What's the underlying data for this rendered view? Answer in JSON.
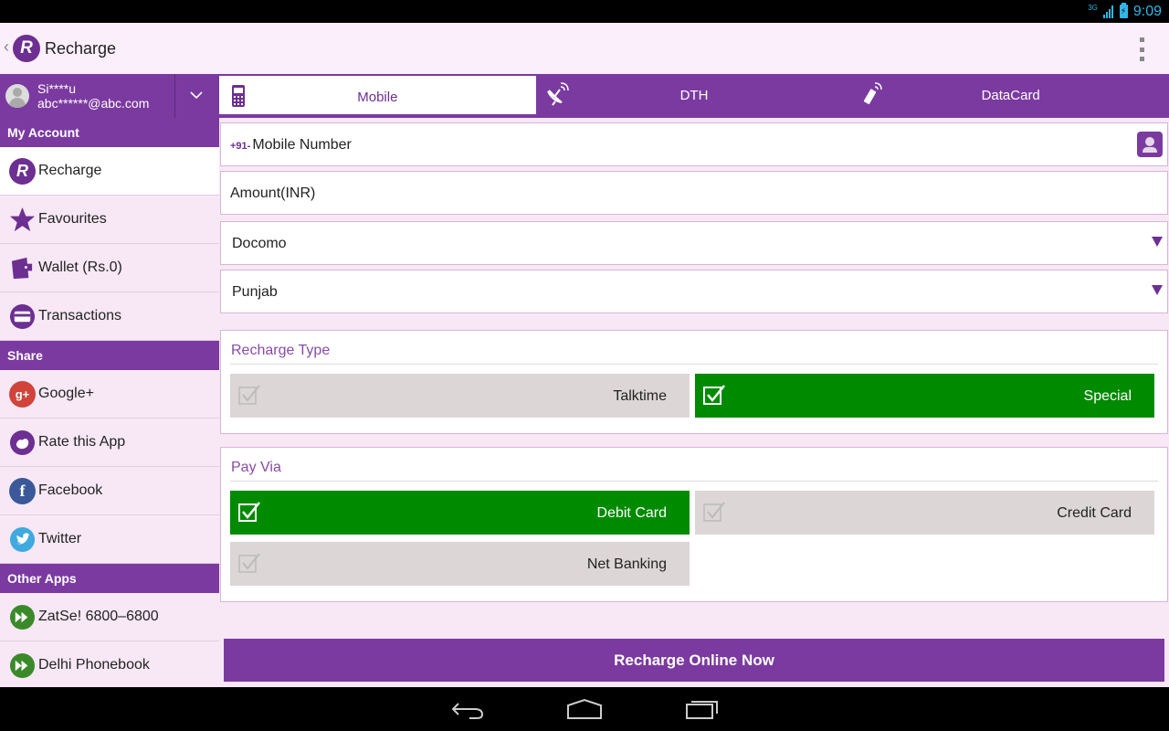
{
  "status_bar": {
    "network": "3G",
    "battery_glyph": "⚡",
    "time": "9:09"
  },
  "action_bar": {
    "logo_letter": "R",
    "title": "Recharge",
    "up_caret": "‹"
  },
  "account": {
    "name": "Si****u",
    "email": "abc******@abc.com"
  },
  "sidebar": {
    "my_account_header": "My Account",
    "my_account_items": [
      {
        "label": "Recharge",
        "icon": "recharge-logo-icon"
      },
      {
        "label": "Favourites",
        "icon": "star-icon"
      },
      {
        "label": "Wallet (Rs.0)",
        "icon": "wallet-icon"
      },
      {
        "label": "Transactions",
        "icon": "card-icon"
      }
    ],
    "share_header": "Share",
    "share_items": [
      {
        "label": "Google+",
        "icon": "google-plus-icon"
      },
      {
        "label": "Rate this App",
        "icon": "rate-icon"
      },
      {
        "label": "Facebook",
        "icon": "facebook-icon"
      },
      {
        "label": "Twitter",
        "icon": "twitter-icon"
      }
    ],
    "other_apps_header": "Other Apps",
    "other_apps_items": [
      {
        "label": "ZatSe! 6800–6800",
        "icon": "app-play-icon"
      },
      {
        "label": "Delhi Phonebook",
        "icon": "app-play-icon"
      }
    ]
  },
  "tabs": [
    {
      "label": "Mobile",
      "selected": true,
      "icon": "mobile-icon"
    },
    {
      "label": "DTH",
      "selected": false,
      "icon": "satellite-dish-icon"
    },
    {
      "label": "DataCard",
      "selected": false,
      "icon": "usb-modem-icon"
    }
  ],
  "form": {
    "mobile_prefix": "+91-",
    "mobile_placeholder": "Mobile Number",
    "amount_placeholder": "Amount(INR)",
    "operator_selected": "Docomo",
    "circle_selected": "Punjab"
  },
  "recharge_type": {
    "title": "Recharge Type",
    "options": [
      {
        "label": "Talktime",
        "checked": false
      },
      {
        "label": "Special",
        "checked": true
      }
    ]
  },
  "pay_via": {
    "title": "Pay Via",
    "options": [
      {
        "label": "Debit Card",
        "checked": true
      },
      {
        "label": "Credit Card",
        "checked": false
      },
      {
        "label": "Net Banking",
        "checked": false
      }
    ]
  },
  "cta_label": "Recharge Online Now",
  "colors": {
    "brand_purple": "#7b3aa0",
    "selected_green": "#008a00",
    "unselected_grey": "#dcd6d6",
    "sidebar_bg": "#f8e8f6",
    "status_blue": "#33b5e5"
  }
}
